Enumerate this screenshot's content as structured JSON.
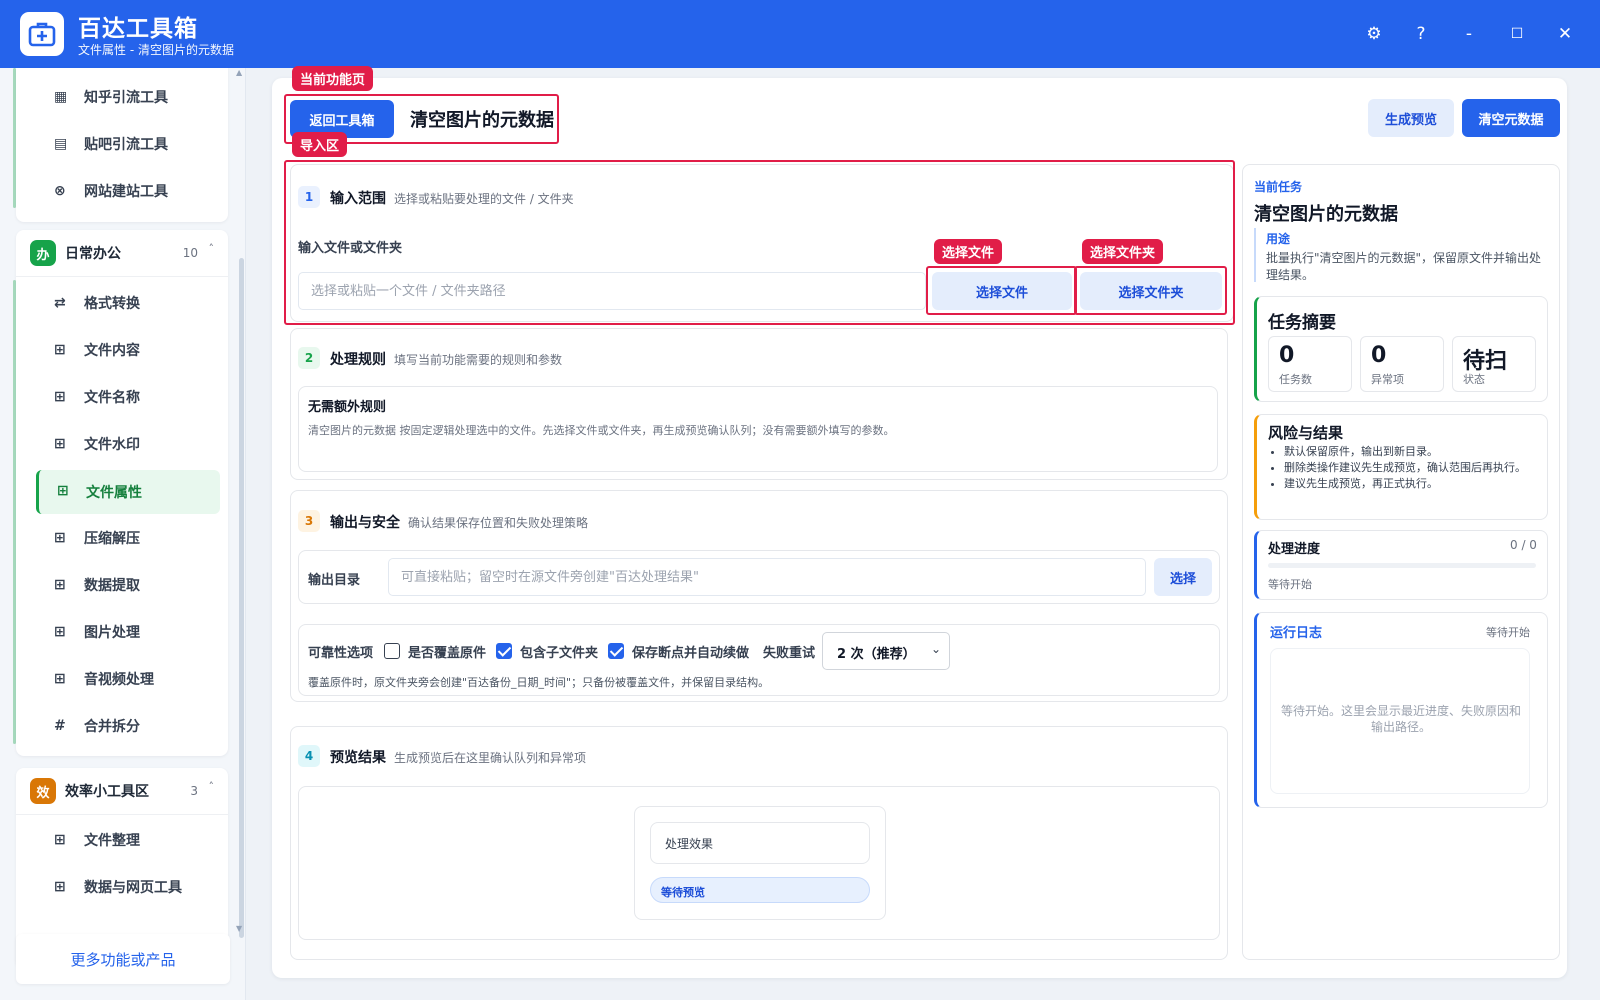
{
  "app": {
    "title": "百达工具箱",
    "subtitle": "文件属性 - 清空图片的元数据"
  },
  "window_controls": {
    "settings": "⚙",
    "help": "?",
    "minimize": "-",
    "maximize": "☐",
    "close": "✕"
  },
  "sidebar": {
    "top_items": [
      {
        "label": "知乎引流工具",
        "icon": "▦"
      },
      {
        "label": "贴吧引流工具",
        "icon": "▤"
      },
      {
        "label": "网站建站工具",
        "icon": "⊗"
      }
    ],
    "group_office": {
      "badge": "办",
      "title": "日常办公",
      "count": "10",
      "caret": "˄",
      "color": "#16a34a",
      "items": [
        {
          "label": "格式转换",
          "icon": "⇄"
        },
        {
          "label": "文件内容",
          "icon": "⊞"
        },
        {
          "label": "文件名称",
          "icon": "⊞"
        },
        {
          "label": "文件水印",
          "icon": "⊞"
        },
        {
          "label": "文件属性",
          "icon": "⊞"
        },
        {
          "label": "压缩解压",
          "icon": "⊞"
        },
        {
          "label": "数据提取",
          "icon": "⊞"
        },
        {
          "label": "图片处理",
          "icon": "⊞"
        },
        {
          "label": "音视频处理",
          "icon": "⊞"
        },
        {
          "label": "合并拆分",
          "icon": "#"
        }
      ]
    },
    "group_tools": {
      "badge": "效",
      "title": "效率小工具区",
      "count": "3",
      "caret": "˄",
      "color": "#d97706",
      "items": [
        {
          "label": "文件整理",
          "icon": "⊞"
        },
        {
          "label": "数据与网页工具",
          "icon": "⊞"
        }
      ]
    },
    "more_label": "更多功能或产品"
  },
  "header": {
    "tag_current": "当前功能页",
    "back_button": "返回工具箱",
    "page_title": "清空图片的元数据",
    "preview_button": "生成预览",
    "run_button": "清空元数据"
  },
  "step1": {
    "tag_import": "导入区",
    "num": "1",
    "title": "输入范围",
    "desc": "选择或粘贴要处理的文件 / 文件夹",
    "field_label": "输入文件或文件夹",
    "input_placeholder": "选择或粘贴一个文件 / 文件夹路径",
    "tag_file": "选择文件",
    "tag_folder": "选择文件夹",
    "file_button": "选择文件",
    "folder_button": "选择文件夹"
  },
  "step2": {
    "num": "2",
    "title": "处理规则",
    "desc": "填写当前功能需要的规则和参数",
    "rule_title": "无需额外规则",
    "rule_desc": "清空图片的元数据 按固定逻辑处理选中的文件。先选择文件或文件夹，再生成预览确认队列；没有需要额外填写的参数。"
  },
  "step3": {
    "num": "3",
    "title": "输出与安全",
    "desc": "确认结果保存位置和失败处理策略",
    "output_label": "输出目录",
    "output_placeholder": "可直接粘贴；留空时在源文件旁创建\"百达处理结果\"",
    "choose_button": "选择",
    "reliability_label": "可靠性选项",
    "opt_overwrite": {
      "label": "是否覆盖原件",
      "checked": false
    },
    "opt_subfolders": {
      "label": "包含子文件夹",
      "checked": true
    },
    "opt_resume": {
      "label": "保存断点并自动续做",
      "checked": true
    },
    "retry_label": "失败重试",
    "retry_value": "2 次（推荐）",
    "note": "覆盖原件时，原文件夹旁会创建\"百达备份_日期_时间\"；只备份被覆盖文件，并保留目录结构。"
  },
  "step4": {
    "num": "4",
    "title": "预览结果",
    "desc": "生成预览后在这里确认队列和异常项",
    "effect_label": "处理效果",
    "status_pill": "等待预览"
  },
  "right": {
    "task_label": "当前任务",
    "task_title": "清空图片的元数据",
    "usage_label": "用途",
    "usage_text": "批量执行\"清空图片的元数据\"，保留原文件并输出处理结果。",
    "summary_title": "任务摘要",
    "stats": [
      {
        "value": "0",
        "label": "任务数"
      },
      {
        "value": "0",
        "label": "异常项"
      },
      {
        "value": "待扫",
        "label": "状态"
      }
    ],
    "risk_title": "风险与结果",
    "risks": [
      "默认保留原件，输出到新目录。",
      "删除类操作建议先生成预览，确认范围后再执行。",
      "建议先生成预览，再正式执行。"
    ],
    "progress_title": "处理进度",
    "progress_count": "0 / 0",
    "progress_value": 0,
    "progress_status": "等待开始",
    "log_title": "运行日志",
    "log_status": "等待开始",
    "log_placeholder": "等待开始。这里会显示最近进度、失败原因和输出路径。"
  },
  "colors": {
    "primary": "#2563eb",
    "annotation": "#e11d48",
    "active_green": "#16a34a",
    "risk_orange": "#f59e0b"
  }
}
